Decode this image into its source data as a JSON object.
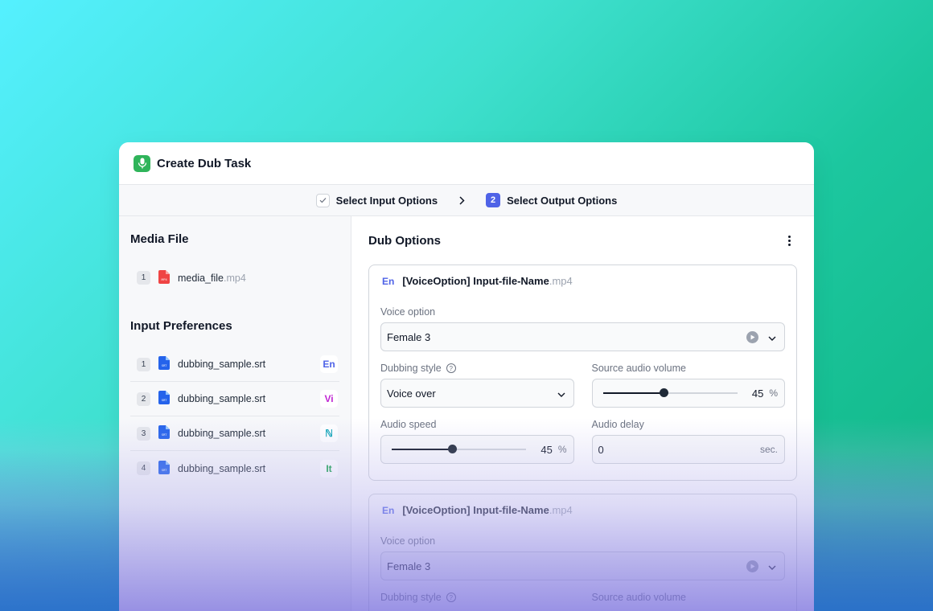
{
  "window": {
    "title": "Create Dub Task"
  },
  "steps": [
    {
      "label": "Select Input Options",
      "state": "done"
    },
    {
      "label": "Select Output Options",
      "number": "2",
      "state": "active"
    }
  ],
  "media": {
    "title": "Media File",
    "files": [
      {
        "index": "1",
        "name": "media_file",
        "ext": ".mp4"
      }
    ]
  },
  "preferences": {
    "title": "Input Preferences",
    "items": [
      {
        "index": "1",
        "name": "dubbing_sample.srt",
        "lang": "En",
        "color": "#4f63e7"
      },
      {
        "index": "2",
        "name": "dubbing_sample.srt",
        "lang": "Vi",
        "color": "#c026d3"
      },
      {
        "index": "3",
        "name": "dubbing_sample.srt",
        "lang": "ℕ",
        "color": "#0ea5b7"
      },
      {
        "index": "4",
        "name": "dubbing_sample.srt",
        "lang": "It",
        "color": "#16a34a"
      }
    ]
  },
  "dub": {
    "title": "Dub Options",
    "cards": [
      {
        "lang": "En",
        "name": "[VoiceOption] Input-file-Name",
        "ext": ".mp4",
        "voice_label": "Voice option",
        "voice_value": "Female 3",
        "style_label": "Dubbing style",
        "style_value": "Voice over",
        "source_label": "Source audio volume",
        "source_value": "45",
        "source_unit": "%",
        "speed_label": "Audio speed",
        "speed_value": "45",
        "speed_unit": "%",
        "delay_label": "Audio delay",
        "delay_value": "0",
        "delay_unit": "sec."
      },
      {
        "lang": "En",
        "name": "[VoiceOption] Input-file-Name",
        "ext": ".mp4",
        "voice_label": "Voice option",
        "voice_value": "Female 3",
        "style_label": "Dubbing style",
        "source_label": "Source audio volume"
      }
    ]
  },
  "colors": {
    "accent": "#4f63e7",
    "app_icon": "#2fb45a",
    "pdf": "#ef4444",
    "srt": "#2563eb"
  }
}
